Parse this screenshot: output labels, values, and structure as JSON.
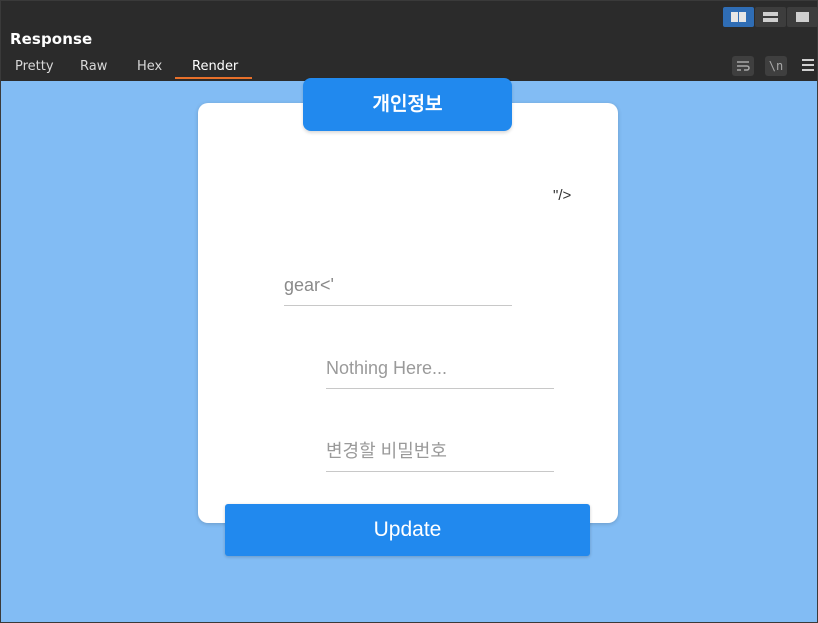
{
  "panel": {
    "title": "Response",
    "tabs": [
      {
        "label": "Pretty",
        "active": false
      },
      {
        "label": "Raw",
        "active": false
      },
      {
        "label": "Hex",
        "active": false
      },
      {
        "label": "Render",
        "active": true
      }
    ],
    "toolbar": {
      "newline_label": "\\n"
    },
    "accent_color": "#e8702a"
  },
  "form": {
    "heading": "개인정보",
    "username_value": "gear<'",
    "stray_text": "\"/>",
    "email_placeholder": "Nothing Here...",
    "password_placeholder": "변경할 비밀번호",
    "submit_label": "Update",
    "brand_color": "#2189ee",
    "background_color": "#82bcf4"
  }
}
